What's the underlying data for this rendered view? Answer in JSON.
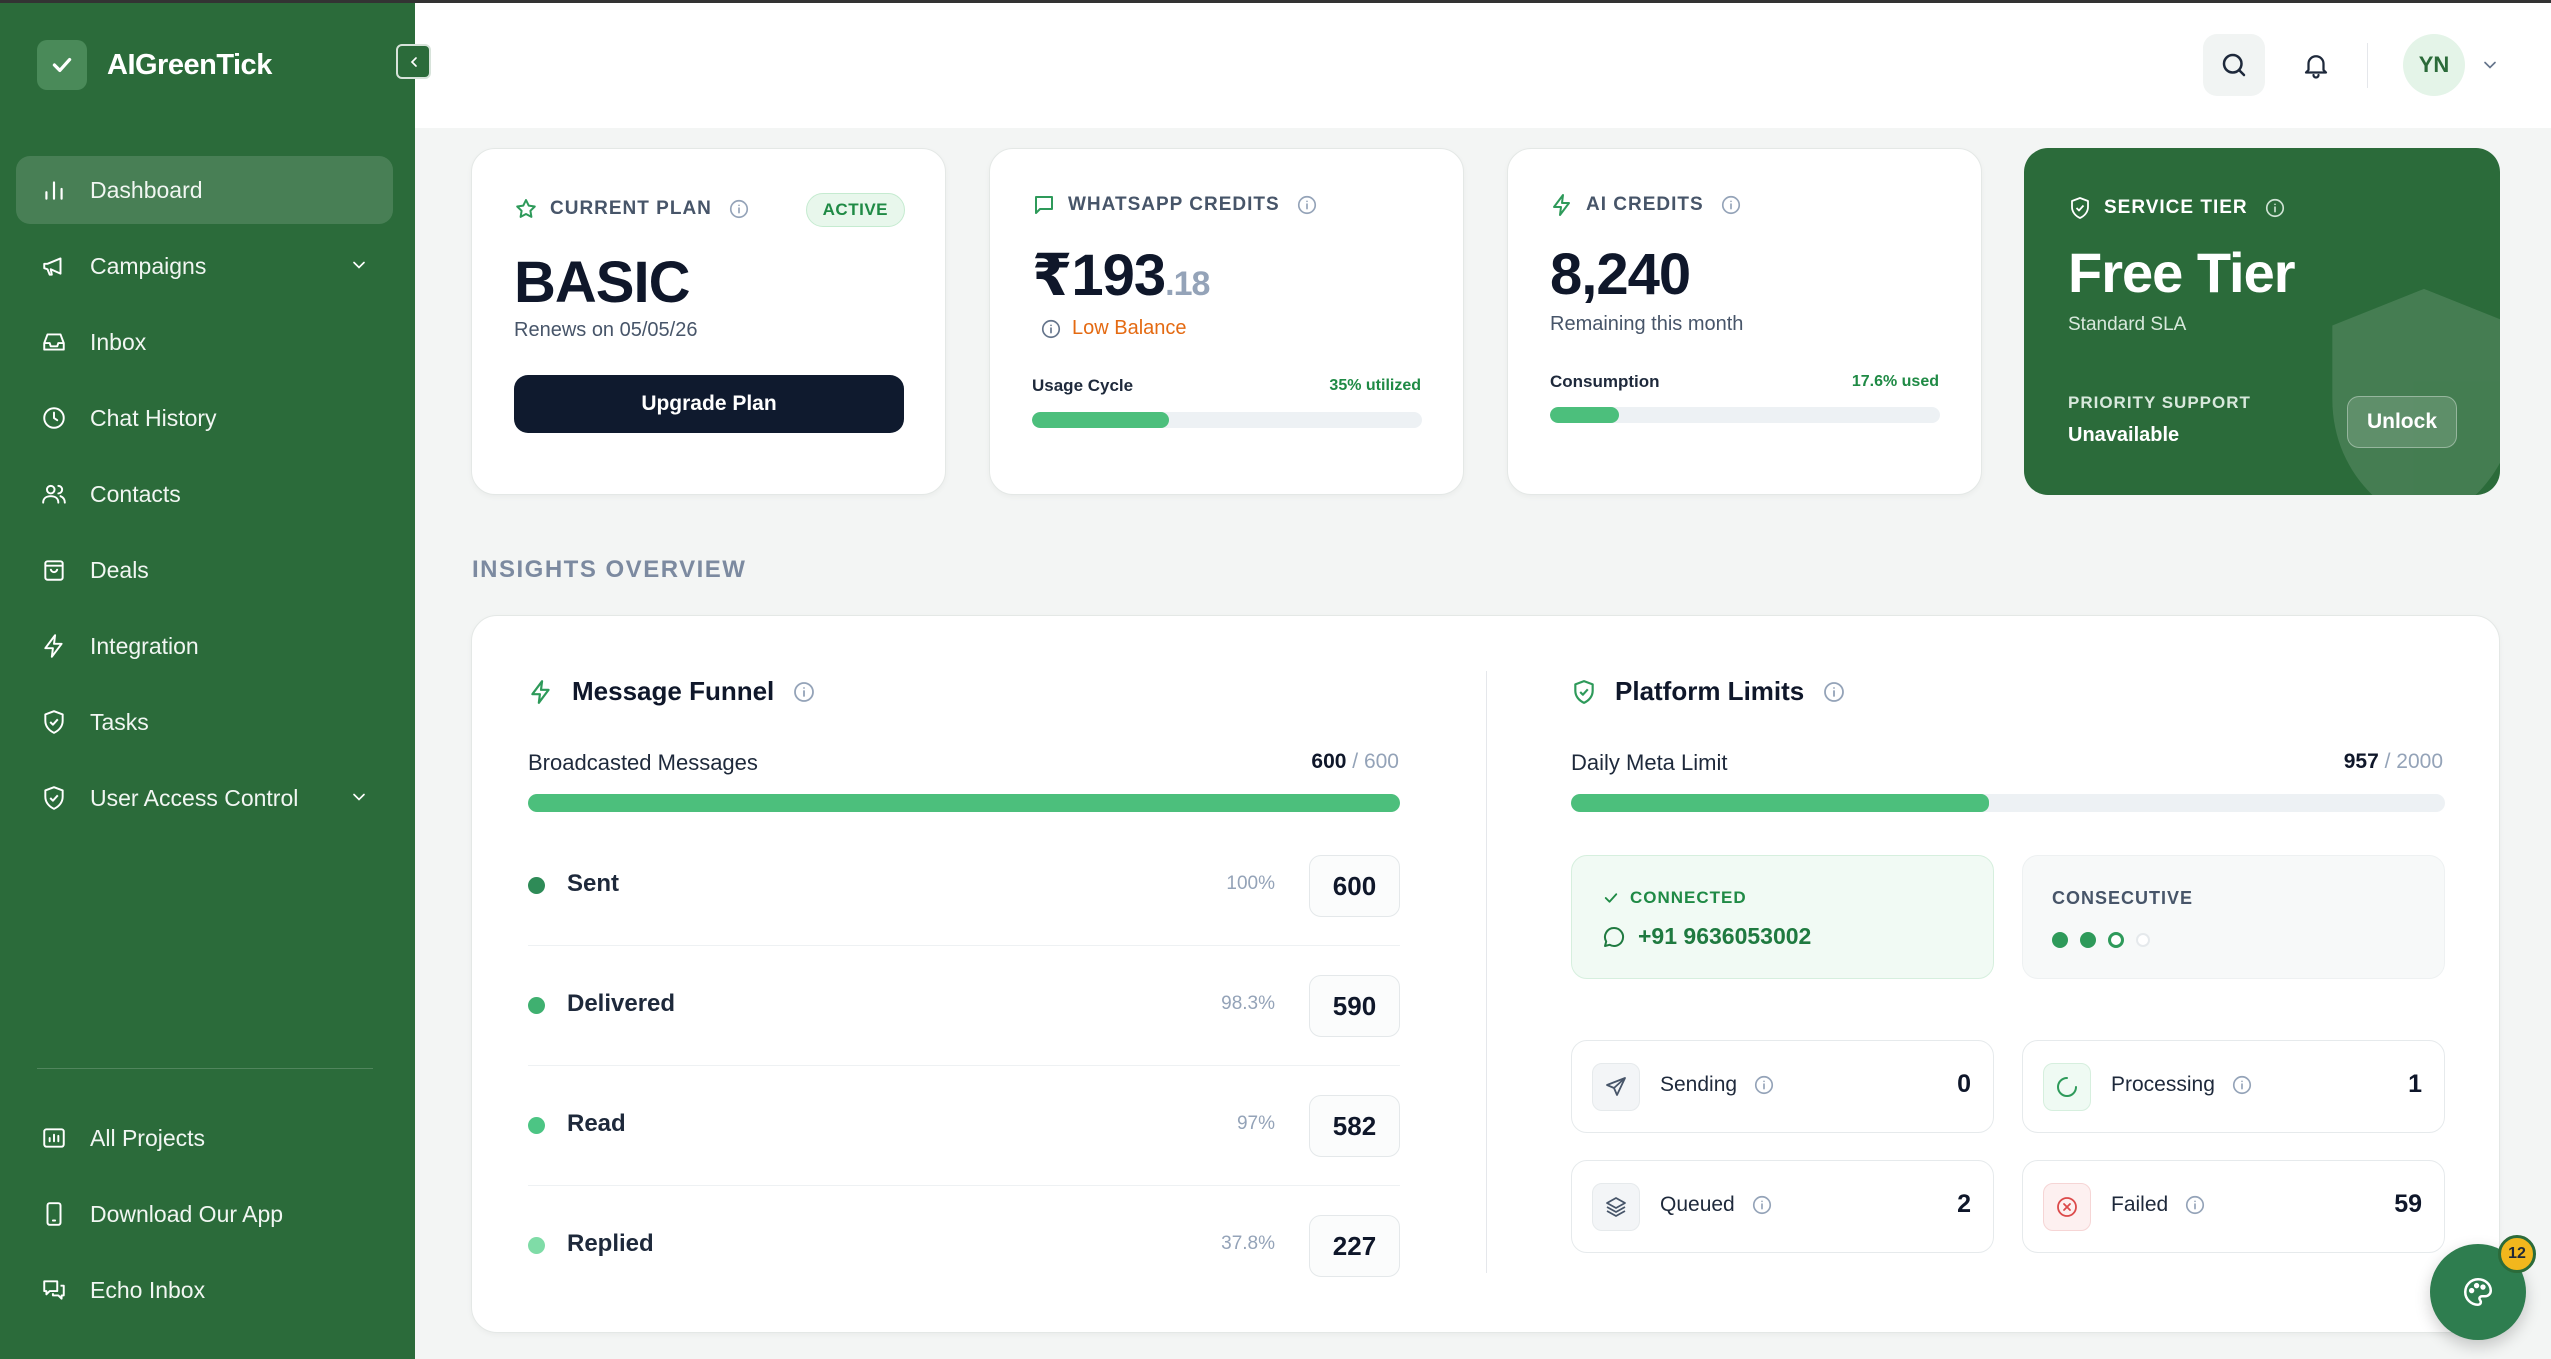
{
  "brand": {
    "name": "AIGreenTick"
  },
  "sidebar": {
    "items": [
      {
        "label": "Dashboard",
        "icon": "bar-chart-icon"
      },
      {
        "label": "Campaigns",
        "icon": "megaphone-icon"
      },
      {
        "label": "Inbox",
        "icon": "inbox-icon"
      },
      {
        "label": "Chat History",
        "icon": "clock-icon"
      },
      {
        "label": "Contacts",
        "icon": "users-icon"
      },
      {
        "label": "Deals",
        "icon": "bag-icon"
      },
      {
        "label": "Integration",
        "icon": "lightning-icon"
      },
      {
        "label": "Tasks",
        "icon": "shield-check-icon"
      },
      {
        "label": "User Access Control",
        "icon": "shield-check-icon"
      }
    ],
    "bottom_items": [
      {
        "label": "All Projects",
        "icon": "projects-icon"
      },
      {
        "label": "Download Our App",
        "icon": "phone-icon"
      },
      {
        "label": "Echo Inbox",
        "icon": "chat-bubbles-icon"
      }
    ]
  },
  "header": {
    "avatar_initials": "YN"
  },
  "cards": {
    "current_plan": {
      "label": "CURRENT PLAN",
      "badge": "ACTIVE",
      "value": "BASIC",
      "renews": "Renews on 05/05/26",
      "button": "Upgrade Plan"
    },
    "whatsapp": {
      "label": "WHATSAPP CREDITS",
      "currency": "₹",
      "value_main": "193",
      "value_dec": ".18",
      "warning": "Low Balance",
      "bar_label": "Usage Cycle",
      "bar_pct_text": "35% utilized",
      "bar_fraction": 0.35
    },
    "ai": {
      "label": "AI CREDITS",
      "value": "8,240",
      "sub": "Remaining this month",
      "bar_label": "Consumption",
      "bar_pct_text": "17.6% used",
      "bar_fraction": 0.176
    },
    "service": {
      "label": "SERVICE TIER",
      "title": "Free Tier",
      "sub": "Standard SLA",
      "priority_label": "PRIORITY SUPPORT",
      "priority_value": "Unavailable",
      "button": "Unlock"
    }
  },
  "insights": {
    "section_title": "INSIGHTS OVERVIEW",
    "funnel": {
      "title": "Message Funnel",
      "bar_label": "Broadcasted Messages",
      "count": "600",
      "total": "/ 600",
      "bar_fraction": 1.0,
      "rows": [
        {
          "label": "Sent",
          "pct": "100%",
          "value": "600",
          "color": "#2e8b57"
        },
        {
          "label": "Delivered",
          "pct": "98.3%",
          "value": "590",
          "color": "#3fb070"
        },
        {
          "label": "Read",
          "pct": "97%",
          "value": "582",
          "color": "#4cc584"
        },
        {
          "label": "Replied",
          "pct": "37.8%",
          "value": "227",
          "color": "#7fdca7"
        }
      ]
    },
    "limits": {
      "title": "Platform Limits",
      "bar_label": "Daily Meta Limit",
      "count": "957",
      "total": "/ 2000",
      "bar_fraction": 0.4785,
      "connected_label": "CONNECTED",
      "phone": "+91 9636053002",
      "consecutive_label": "CONSECUTIVE",
      "tiles": [
        {
          "label": "Sending",
          "value": "0",
          "icon": "send-icon"
        },
        {
          "label": "Processing",
          "value": "1",
          "icon": "spinner-icon"
        },
        {
          "label": "Queued",
          "value": "2",
          "icon": "layers-icon"
        },
        {
          "label": "Failed",
          "value": "59",
          "icon": "x-circle-icon"
        }
      ]
    }
  },
  "fab": {
    "badge": "12"
  }
}
